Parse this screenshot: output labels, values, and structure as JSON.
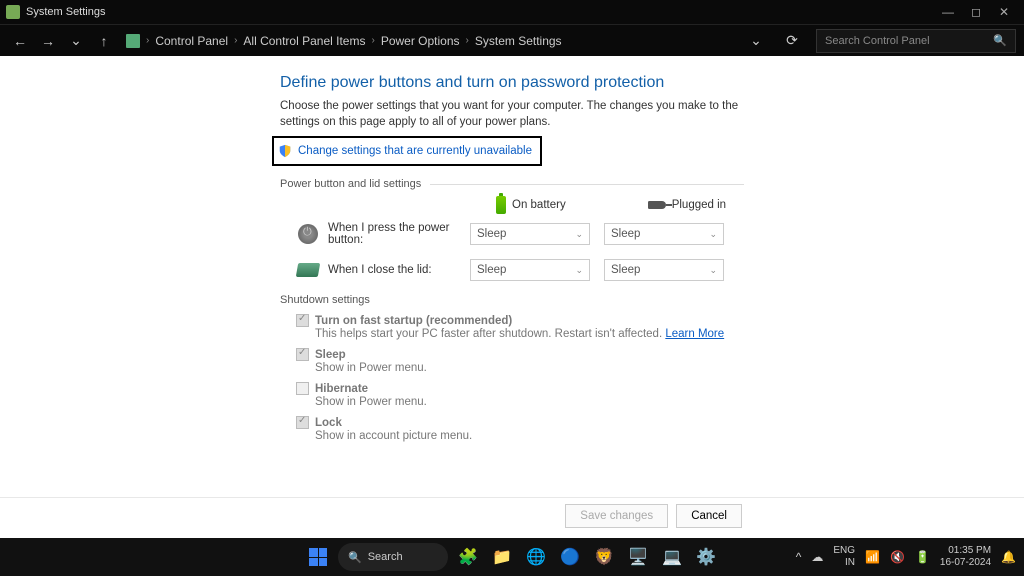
{
  "titlebar": {
    "title": "System Settings"
  },
  "breadcrumb": [
    "Control Panel",
    "All Control Panel Items",
    "Power Options",
    "System Settings"
  ],
  "search": {
    "placeholder": "Search Control Panel"
  },
  "page": {
    "heading": "Define power buttons and turn on password protection",
    "subtext": "Choose the power settings that you want for your computer. The changes you make to the settings on this page apply to all of your power plans.",
    "change_link": "Change settings that are currently unavailable",
    "section_power": "Power button and lid settings",
    "col_battery": "On battery",
    "col_plugged": "Plugged in",
    "row_power_button": "When I press the power button:",
    "row_lid": "When I close the lid:",
    "dropdown_value": "Sleep",
    "section_shutdown": "Shutdown settings",
    "shutdown_items": [
      {
        "title": "Turn on fast startup (recommended)",
        "desc": "This helps start your PC faster after shutdown. Restart isn't affected. ",
        "learn": "Learn More",
        "checked": true
      },
      {
        "title": "Sleep",
        "desc": "Show in Power menu.",
        "checked": true
      },
      {
        "title": "Hibernate",
        "desc": "Show in Power menu.",
        "checked": false
      },
      {
        "title": "Lock",
        "desc": "Show in account picture menu.",
        "checked": true
      }
    ],
    "save_btn": "Save changes",
    "cancel_btn": "Cancel"
  },
  "taskbar": {
    "search": "Search",
    "lang1": "ENG",
    "lang2": "IN",
    "time": "01:35 PM",
    "date": "16-07-2024"
  }
}
